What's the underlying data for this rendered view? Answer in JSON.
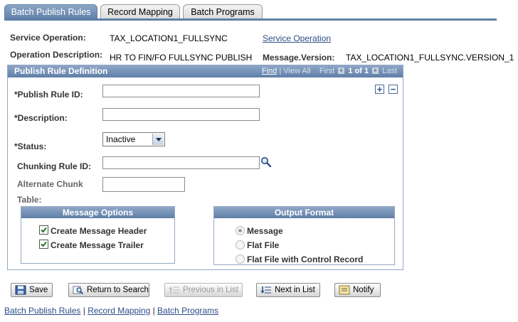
{
  "tabs": [
    {
      "label": "Batch Publish Rules",
      "active": true
    },
    {
      "label": "Record Mapping",
      "active": false
    },
    {
      "label": "Batch Programs",
      "active": false
    }
  ],
  "header": {
    "service_operation_label": "Service Operation:",
    "service_operation_value": "TAX_LOCATION1_FULLSYNC",
    "service_operation_link": "Service Operation",
    "operation_description_label": "Operation Description:",
    "operation_description_value": "HR TO FIN/FO FULLSYNC PUBLISH",
    "message_version_label": "Message.Version:",
    "message_version_value": "TAX_LOCATION1_FULLSYNC.VERSION_1"
  },
  "publish_rule": {
    "title": "Publish Rule Definition",
    "nav": {
      "find": "Find",
      "view_all": "View All",
      "first": "First",
      "count": "1 of 1",
      "last": "Last"
    },
    "add_symbol": "+",
    "remove_symbol": "−",
    "fields": {
      "publish_rule_id_label": "*Publish Rule ID:",
      "publish_rule_id_value": "",
      "description_label": "*Description:",
      "description_value": "",
      "status_label": "*Status:",
      "status_value": "Inactive",
      "chunking_rule_label": "Chunking Rule ID:",
      "chunking_rule_value": "",
      "alternate_chunk_label": "Alternate Chunk",
      "alternate_chunk_label2": "Table:",
      "alternate_chunk_value": ""
    },
    "message_options": {
      "title": "Message Options",
      "items": [
        {
          "label": "Create Message Header",
          "checked": true
        },
        {
          "label": "Create Message Trailer",
          "checked": true
        }
      ]
    },
    "output_format": {
      "title": "Output Format",
      "options": [
        {
          "label": "Message",
          "selected": true
        },
        {
          "label": "Flat File",
          "selected": false
        },
        {
          "label": "Flat File with Control Record",
          "selected": false
        }
      ]
    }
  },
  "toolbar": {
    "save": "Save",
    "return_to_search": "Return to Search",
    "previous_in_list": "Previous in List",
    "next_in_list": "Next in List",
    "notify": "Notify"
  },
  "footer": {
    "links": [
      "Batch Publish Rules",
      "Record Mapping",
      "Batch Programs"
    ],
    "separator": " | "
  },
  "colors": {
    "header_blue": "#5f7fa8",
    "link_blue": "#2a4e8a"
  }
}
